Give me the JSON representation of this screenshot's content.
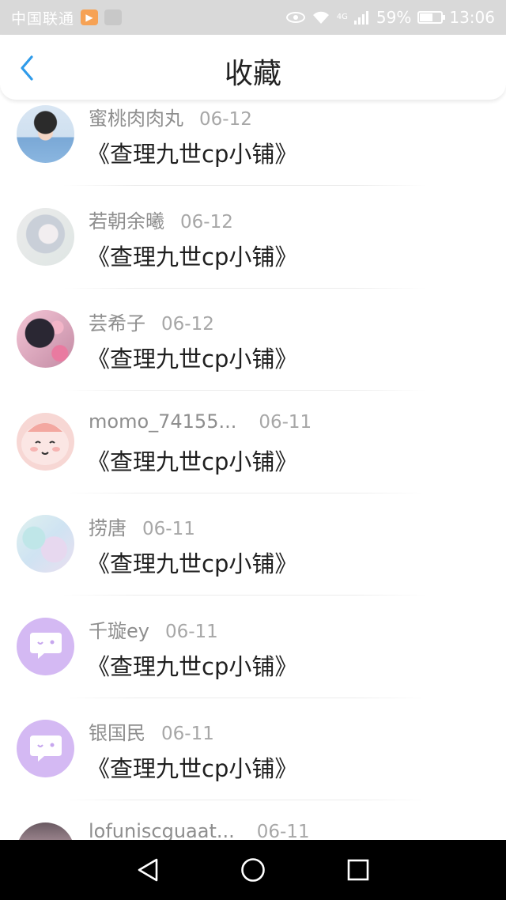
{
  "status_bar": {
    "carrier": "中国联通",
    "network": "4G",
    "battery": "59%",
    "battery_level": 0.59,
    "time": "13:06"
  },
  "header": {
    "title": "收藏",
    "back_icon": "chevron-left-icon"
  },
  "colors": {
    "accent": "#2f9bea",
    "status_bar_bg": "#d9d9d9",
    "name_text": "#8e8e8e",
    "title_text": "#1f1f1f",
    "chat_avatar": "#d4b9f3"
  },
  "favorites": [
    {
      "name": "蜜桃肉肉丸",
      "date": "06-12",
      "title": "《查理九世cp小铺》"
    },
    {
      "name": "若朝余曦",
      "date": "06-12",
      "title": "《查理九世cp小铺》"
    },
    {
      "name": "芸希子",
      "date": "06-12",
      "title": "《查理九世cp小铺》"
    },
    {
      "name": "momo_74155...",
      "date": "06-11",
      "title": "《查理九世cp小铺》"
    },
    {
      "name": "捞唐",
      "date": "06-11",
      "title": "《查理九世cp小铺》"
    },
    {
      "name": "千璇ey",
      "date": "06-11",
      "title": "《查理九世cp小铺》"
    },
    {
      "name": "银国民",
      "date": "06-11",
      "title": "《查理九世cp小铺》"
    },
    {
      "name": "lofuniscguaat...",
      "date": "06-11",
      "title": ""
    }
  ],
  "nav_bar": {
    "back": "triangle-back-icon",
    "home": "circle-home-icon",
    "recents": "square-recents-icon"
  }
}
